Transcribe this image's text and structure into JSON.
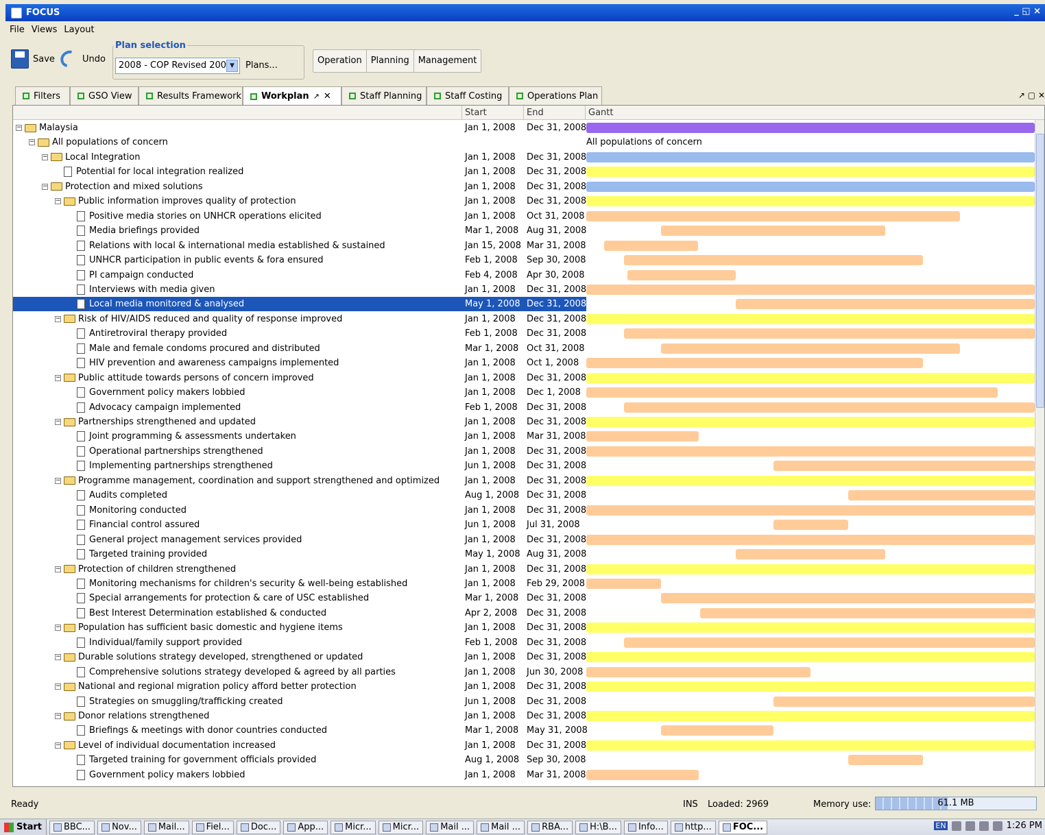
{
  "window": {
    "title": "FOCUS",
    "controls": "_ ◱ ×"
  },
  "menu": [
    "File",
    "Views",
    "Layout"
  ],
  "toolbar": {
    "save": "Save",
    "undo": "Undo",
    "plan_selection_label": "Plan selection",
    "plan_selected": "2008 - COP Revised 2008",
    "plans_link": "Plans...",
    "modes": [
      "Operation",
      "Planning",
      "Management"
    ]
  },
  "tabs": [
    "Filters",
    "GSO View",
    "Results Framework",
    "Workplan",
    "Staff Planning",
    "Staff Costing",
    "Operations Plan"
  ],
  "active_tab": "Workplan",
  "columns": {
    "start": "Start",
    "end": "End",
    "gantt": "Gantt"
  },
  "colors": {
    "purple": "#9966ee",
    "blue": "#99bbee",
    "yellow": "#ffff66",
    "orange": "#ffcc99",
    "selection": "#1c56b8"
  },
  "rows": [
    {
      "label": "Malaysia",
      "level": 0,
      "type": "folder",
      "start": "Jan 1, 2008",
      "end": "Dec 31, 2008",
      "color": "purple",
      "s": 0,
      "e": 12
    },
    {
      "label": "All populations of concern",
      "level": 1,
      "type": "folder",
      "start": "",
      "end": "",
      "gantt_label": "All populations of concern"
    },
    {
      "label": "Local Integration",
      "level": 2,
      "type": "folder",
      "start": "Jan 1, 2008",
      "end": "Dec 31, 2008",
      "color": "blue",
      "s": 0,
      "e": 12
    },
    {
      "label": "Potential for local integration realized",
      "level": 3,
      "type": "doc",
      "start": "Jan 1, 2008",
      "end": "Dec 31, 2008",
      "color": "yellow",
      "s": 0,
      "e": 12
    },
    {
      "label": "Protection and mixed solutions",
      "level": 2,
      "type": "folder",
      "start": "Jan 1, 2008",
      "end": "Dec 31, 2008",
      "color": "blue",
      "s": 0,
      "e": 12
    },
    {
      "label": "Public information improves quality of protection",
      "level": 3,
      "type": "folder",
      "start": "Jan 1, 2008",
      "end": "Dec 31, 2008",
      "color": "yellow",
      "s": 0,
      "e": 12
    },
    {
      "label": "Positive media stories on UNHCR operations elicited",
      "level": 4,
      "type": "doc",
      "start": "Jan 1, 2008",
      "end": "Oct 31, 2008",
      "color": "orange",
      "s": 0,
      "e": 10
    },
    {
      "label": "Media briefings provided",
      "level": 4,
      "type": "doc",
      "start": "Mar 1, 2008",
      "end": "Aug 31, 2008",
      "color": "orange",
      "s": 2,
      "e": 8
    },
    {
      "label": "Relations with local & international media established & sustained",
      "level": 4,
      "type": "doc",
      "start": "Jan 15, 2008",
      "end": "Mar 31, 2008",
      "color": "orange",
      "s": 0.47,
      "e": 3
    },
    {
      "label": "UNHCR participation in public events & fora ensured",
      "level": 4,
      "type": "doc",
      "start": "Feb 1, 2008",
      "end": "Sep 30, 2008",
      "color": "orange",
      "s": 1,
      "e": 9
    },
    {
      "label": "PI campaign conducted",
      "level": 4,
      "type": "doc",
      "start": "Feb 4, 2008",
      "end": "Apr 30, 2008",
      "color": "orange",
      "s": 1.1,
      "e": 4
    },
    {
      "label": "Interviews with media given",
      "level": 4,
      "type": "doc",
      "start": "Jan 1, 2008",
      "end": "Dec 31, 2008",
      "color": "orange",
      "s": 0,
      "e": 12
    },
    {
      "label": "Local media monitored & analysed",
      "level": 4,
      "type": "doc",
      "start": "May 1, 2008",
      "end": "Dec 31, 2008",
      "color": "orange",
      "s": 4,
      "e": 12,
      "selected": true
    },
    {
      "label": "Risk of HIV/AIDS reduced and quality of response improved",
      "level": 3,
      "type": "folder",
      "start": "Jan 1, 2008",
      "end": "Dec 31, 2008",
      "color": "yellow",
      "s": 0,
      "e": 12
    },
    {
      "label": "Antiretroviral therapy provided",
      "level": 4,
      "type": "doc",
      "start": "Feb 1, 2008",
      "end": "Dec 31, 2008",
      "color": "orange",
      "s": 1,
      "e": 12
    },
    {
      "label": "Male and female condoms procured and distributed",
      "level": 4,
      "type": "doc",
      "start": "Mar 1, 2008",
      "end": "Oct 31, 2008",
      "color": "orange",
      "s": 2,
      "e": 10
    },
    {
      "label": "HIV prevention and awareness campaigns implemented",
      "level": 4,
      "type": "doc",
      "start": "Jan 1, 2008",
      "end": "Oct 1, 2008",
      "color": "orange",
      "s": 0,
      "e": 9
    },
    {
      "label": "Public attitude towards persons of concern improved",
      "level": 3,
      "type": "folder",
      "start": "Jan 1, 2008",
      "end": "Dec 31, 2008",
      "color": "yellow",
      "s": 0,
      "e": 12
    },
    {
      "label": "Government policy makers lobbied",
      "level": 4,
      "type": "doc",
      "start": "Jan 1, 2008",
      "end": "Dec 1, 2008",
      "color": "orange",
      "s": 0,
      "e": 11
    },
    {
      "label": "Advocacy campaign implemented",
      "level": 4,
      "type": "doc",
      "start": "Feb 1, 2008",
      "end": "Dec 31, 2008",
      "color": "orange",
      "s": 1,
      "e": 12
    },
    {
      "label": "Partnerships strengthened and updated",
      "level": 3,
      "type": "folder",
      "start": "Jan 1, 2008",
      "end": "Dec 31, 2008",
      "color": "yellow",
      "s": 0,
      "e": 12
    },
    {
      "label": "Joint programming & assessments undertaken",
      "level": 4,
      "type": "doc",
      "start": "Jan 1, 2008",
      "end": "Mar 31, 2008",
      "color": "orange",
      "s": 0,
      "e": 3
    },
    {
      "label": "Operational partnerships strengthened",
      "level": 4,
      "type": "doc",
      "start": "Jan 1, 2008",
      "end": "Dec 31, 2008",
      "color": "orange",
      "s": 0,
      "e": 12
    },
    {
      "label": "Implementing partnerships strengthened",
      "level": 4,
      "type": "doc",
      "start": "Jun 1, 2008",
      "end": "Dec 31, 2008",
      "color": "orange",
      "s": 5,
      "e": 12
    },
    {
      "label": "Programme management, coordination and support strengthened and optimized",
      "level": 3,
      "type": "folder",
      "start": "Jan 1, 2008",
      "end": "Dec 31, 2008",
      "color": "yellow",
      "s": 0,
      "e": 12
    },
    {
      "label": "Audits completed",
      "level": 4,
      "type": "doc",
      "start": "Aug 1, 2008",
      "end": "Dec 31, 2008",
      "color": "orange",
      "s": 7,
      "e": 12
    },
    {
      "label": "Monitoring conducted",
      "level": 4,
      "type": "doc",
      "start": "Jan 1, 2008",
      "end": "Dec 31, 2008",
      "color": "orange",
      "s": 0,
      "e": 12
    },
    {
      "label": "Financial control assured",
      "level": 4,
      "type": "doc",
      "start": "Jun 1, 2008",
      "end": "Jul 31, 2008",
      "color": "orange",
      "s": 5,
      "e": 7
    },
    {
      "label": "General project management services provided",
      "level": 4,
      "type": "doc",
      "start": "Jan 1, 2008",
      "end": "Dec 31, 2008",
      "color": "orange",
      "s": 0,
      "e": 12
    },
    {
      "label": "Targeted training provided",
      "level": 4,
      "type": "doc",
      "start": "May 1, 2008",
      "end": "Aug 31, 2008",
      "color": "orange",
      "s": 4,
      "e": 8
    },
    {
      "label": "Protection of children strengthened",
      "level": 3,
      "type": "folder",
      "start": "Jan 1, 2008",
      "end": "Dec 31, 2008",
      "color": "yellow",
      "s": 0,
      "e": 12
    },
    {
      "label": "Monitoring mechanisms for children's security & well-being established",
      "level": 4,
      "type": "doc",
      "start": "Jan 1, 2008",
      "end": "Feb 29, 2008",
      "color": "orange",
      "s": 0,
      "e": 2
    },
    {
      "label": "Special arrangements for protection & care of USC established",
      "level": 4,
      "type": "doc",
      "start": "Mar 1, 2008",
      "end": "Dec 31, 2008",
      "color": "orange",
      "s": 2,
      "e": 12
    },
    {
      "label": "Best Interest Determination established & conducted",
      "level": 4,
      "type": "doc",
      "start": "Apr 2, 2008",
      "end": "Dec 31, 2008",
      "color": "orange",
      "s": 3.05,
      "e": 12
    },
    {
      "label": "Population has sufficient basic domestic and hygiene items",
      "level": 3,
      "type": "folder",
      "start": "Jan 1, 2008",
      "end": "Dec 31, 2008",
      "color": "yellow",
      "s": 0,
      "e": 12
    },
    {
      "label": "Individual/family support provided",
      "level": 4,
      "type": "doc",
      "start": "Feb 1, 2008",
      "end": "Dec 31, 2008",
      "color": "orange",
      "s": 1,
      "e": 12
    },
    {
      "label": "Durable solutions strategy developed, strengthened or updated",
      "level": 3,
      "type": "folder",
      "start": "Jan 1, 2008",
      "end": "Dec 31, 2008",
      "color": "yellow",
      "s": 0,
      "e": 12
    },
    {
      "label": "Comprehensive solutions strategy developed & agreed by all parties",
      "level": 4,
      "type": "doc",
      "start": "Jan 1, 2008",
      "end": "Jun 30, 2008",
      "color": "orange",
      "s": 0,
      "e": 6
    },
    {
      "label": "National and regional migration policy afford better protection",
      "level": 3,
      "type": "folder",
      "start": "Jan 1, 2008",
      "end": "Dec 31, 2008",
      "color": "yellow",
      "s": 0,
      "e": 12
    },
    {
      "label": "Strategies on smuggling/trafficking created",
      "level": 4,
      "type": "doc",
      "start": "Jun 1, 2008",
      "end": "Dec 31, 2008",
      "color": "orange",
      "s": 5,
      "e": 12
    },
    {
      "label": "Donor relations strengthened",
      "level": 3,
      "type": "folder",
      "start": "Jan 1, 2008",
      "end": "Dec 31, 2008",
      "color": "yellow",
      "s": 0,
      "e": 12
    },
    {
      "label": "Briefings & meetings with donor countries conducted",
      "level": 4,
      "type": "doc",
      "start": "Mar 1, 2008",
      "end": "May 31, 2008",
      "color": "orange",
      "s": 2,
      "e": 5
    },
    {
      "label": "Level of individual documentation increased",
      "level": 3,
      "type": "folder",
      "start": "Jan 1, 2008",
      "end": "Dec 31, 2008",
      "color": "yellow",
      "s": 0,
      "e": 12
    },
    {
      "label": "Targeted training for government officials provided",
      "level": 4,
      "type": "doc",
      "start": "Aug 1, 2008",
      "end": "Sep 30, 2008",
      "color": "orange",
      "s": 7,
      "e": 9
    },
    {
      "label": "Government policy makers lobbied",
      "level": 4,
      "type": "doc",
      "start": "Jan 1, 2008",
      "end": "Mar 31, 2008",
      "color": "orange",
      "s": 0,
      "e": 3
    }
  ],
  "status": {
    "ready": "Ready",
    "ins": "INS",
    "loaded": "Loaded: 2969",
    "memory_label": "Memory use:",
    "memory_value": "61.1 MB",
    "memory_fraction": 0.45
  },
  "taskbar": {
    "start": "Start",
    "items": [
      "BBC...",
      "Nov...",
      "Mail...",
      "Fiel...",
      "Doc...",
      "App...",
      "Micr...",
      "Micr...",
      "Mail ...",
      "Mail ...",
      "RBA...",
      "H:\\B...",
      "Info...",
      "http...",
      "FOC..."
    ],
    "active": "FOC...",
    "lang": "EN",
    "clock": "1:26 PM"
  }
}
